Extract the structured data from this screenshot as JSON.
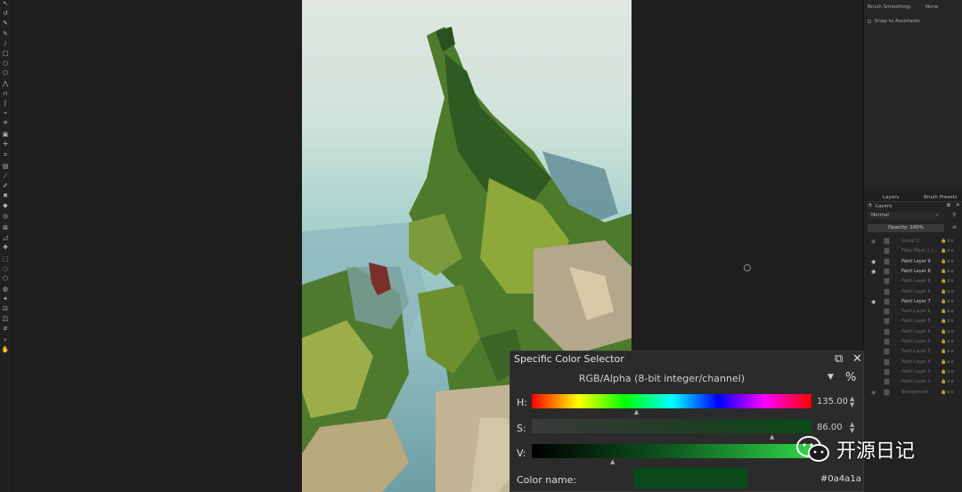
{
  "toolbox": {
    "tools": [
      {
        "name": "select-shapes-tool-icon",
        "glyph": "↖"
      },
      {
        "name": "edit-shapes-tool-icon",
        "glyph": "↺"
      },
      {
        "name": "text-tool-icon",
        "glyph": "✎"
      },
      {
        "name": "freehand-brush-tool-icon",
        "glyph": "✎"
      },
      {
        "name": "line-tool-icon",
        "glyph": "/"
      },
      {
        "name": "rectangle-tool-icon",
        "glyph": "□"
      },
      {
        "name": "ellipse-tool-icon",
        "glyph": "○"
      },
      {
        "name": "polygon-tool-icon",
        "glyph": "⬠"
      },
      {
        "name": "polyline-tool-icon",
        "glyph": "⋀"
      },
      {
        "name": "bezier-curve-tool-icon",
        "glyph": "∩"
      },
      {
        "name": "freehand-path-tool-icon",
        "glyph": "ʃ"
      },
      {
        "name": "dynamic-brush-tool-icon",
        "glyph": "⌁"
      },
      {
        "name": "multibrush-tool-icon",
        "glyph": "✳"
      },
      {
        "name": "transform-tool-icon",
        "glyph": "▣"
      },
      {
        "name": "move-tool-icon",
        "glyph": "✛"
      },
      {
        "name": "crop-tool-icon",
        "glyph": "⌗"
      },
      {
        "name": "gradient-tool-icon",
        "glyph": "▤"
      },
      {
        "name": "color-sampler-tool-icon",
        "glyph": "⁄"
      },
      {
        "name": "colorize-mask-tool-icon",
        "glyph": "✐"
      },
      {
        "name": "smart-patch-tool-icon",
        "glyph": "✖"
      },
      {
        "name": "fill-tool-icon",
        "glyph": "◆"
      },
      {
        "name": "enclose-fill-tool-icon",
        "glyph": "◎"
      },
      {
        "name": "assistant-tool-icon",
        "glyph": "⊠"
      },
      {
        "name": "measure-tool-icon",
        "glyph": "◿"
      },
      {
        "name": "reference-tool-icon",
        "glyph": "✚"
      },
      {
        "name": "rectangular-selection-tool-icon",
        "glyph": "⬚"
      },
      {
        "name": "elliptical-selection-tool-icon",
        "glyph": "◌"
      },
      {
        "name": "polygonal-selection-tool-icon",
        "glyph": "⬡"
      },
      {
        "name": "freehand-selection-tool-icon",
        "glyph": "◍"
      },
      {
        "name": "contiguous-selection-tool-icon",
        "glyph": "✦"
      },
      {
        "name": "similar-selection-tool-icon",
        "glyph": "⊡"
      },
      {
        "name": "bezier-selection-tool-icon",
        "glyph": "◫"
      },
      {
        "name": "magnetic-selection-tool-icon",
        "glyph": "⧄"
      },
      {
        "name": "zoom-tool-icon",
        "glyph": "⌕"
      },
      {
        "name": "pan-tool-icon",
        "glyph": "✋"
      }
    ]
  },
  "tool_options": {
    "brush_smoothing_label": "Brush Smoothing:",
    "brush_smoothing_value": "None",
    "snap_label": "Snap to Assistants"
  },
  "dock_tabs": {
    "layers": "Layers",
    "brush_presets": "Brush Presets"
  },
  "layers": {
    "title": "Layers",
    "blend_mode": "Normal",
    "opacity": "Opacity:  100%",
    "items": [
      {
        "name": "Group 2",
        "bright": false,
        "visible": true
      },
      {
        "name": "Filter Mask 1 (...",
        "bright": false,
        "visible": false
      },
      {
        "name": "Paint Layer 9",
        "bright": true,
        "visible": true
      },
      {
        "name": "Paint Layer 8",
        "bright": true,
        "visible": true
      },
      {
        "name": "Paint Layer 6",
        "bright": false,
        "visible": false
      },
      {
        "name": "Paint Layer 6",
        "bright": false,
        "visible": false
      },
      {
        "name": "Paint Layer 7",
        "bright": true,
        "visible": true
      },
      {
        "name": "Paint Layer 6",
        "bright": false,
        "visible": false
      },
      {
        "name": "Paint Layer 5",
        "bright": false,
        "visible": false
      },
      {
        "name": "Paint Layer 6",
        "bright": false,
        "visible": false
      },
      {
        "name": "Paint Layer 5",
        "bright": false,
        "visible": false
      },
      {
        "name": "Paint Layer 5",
        "bright": false,
        "visible": false
      },
      {
        "name": "Paint Layer 4",
        "bright": false,
        "visible": false
      },
      {
        "name": "Paint Layer 3",
        "bright": false,
        "visible": false
      },
      {
        "name": "Paint Layer 1",
        "bright": false,
        "visible": false
      },
      {
        "name": "Background",
        "bright": false,
        "visible": true
      }
    ]
  },
  "color_selector": {
    "title": "Specific Color Selector",
    "model": "RGB/Alpha (8-bit integer/channel)",
    "percent_toggle": "%",
    "hue_label": "H:",
    "hue_value": "135.00",
    "hue_fraction": 0.375,
    "sat_label": "S:",
    "sat_value": "86.00",
    "sat_fraction": 0.86,
    "val_label": "V:",
    "val_fraction": 0.29,
    "color_name_label": "Color name:",
    "color_hex": "#0a4a1a",
    "swatch_color": "#0a4a1a"
  },
  "watermark": {
    "text": "开源日记"
  }
}
